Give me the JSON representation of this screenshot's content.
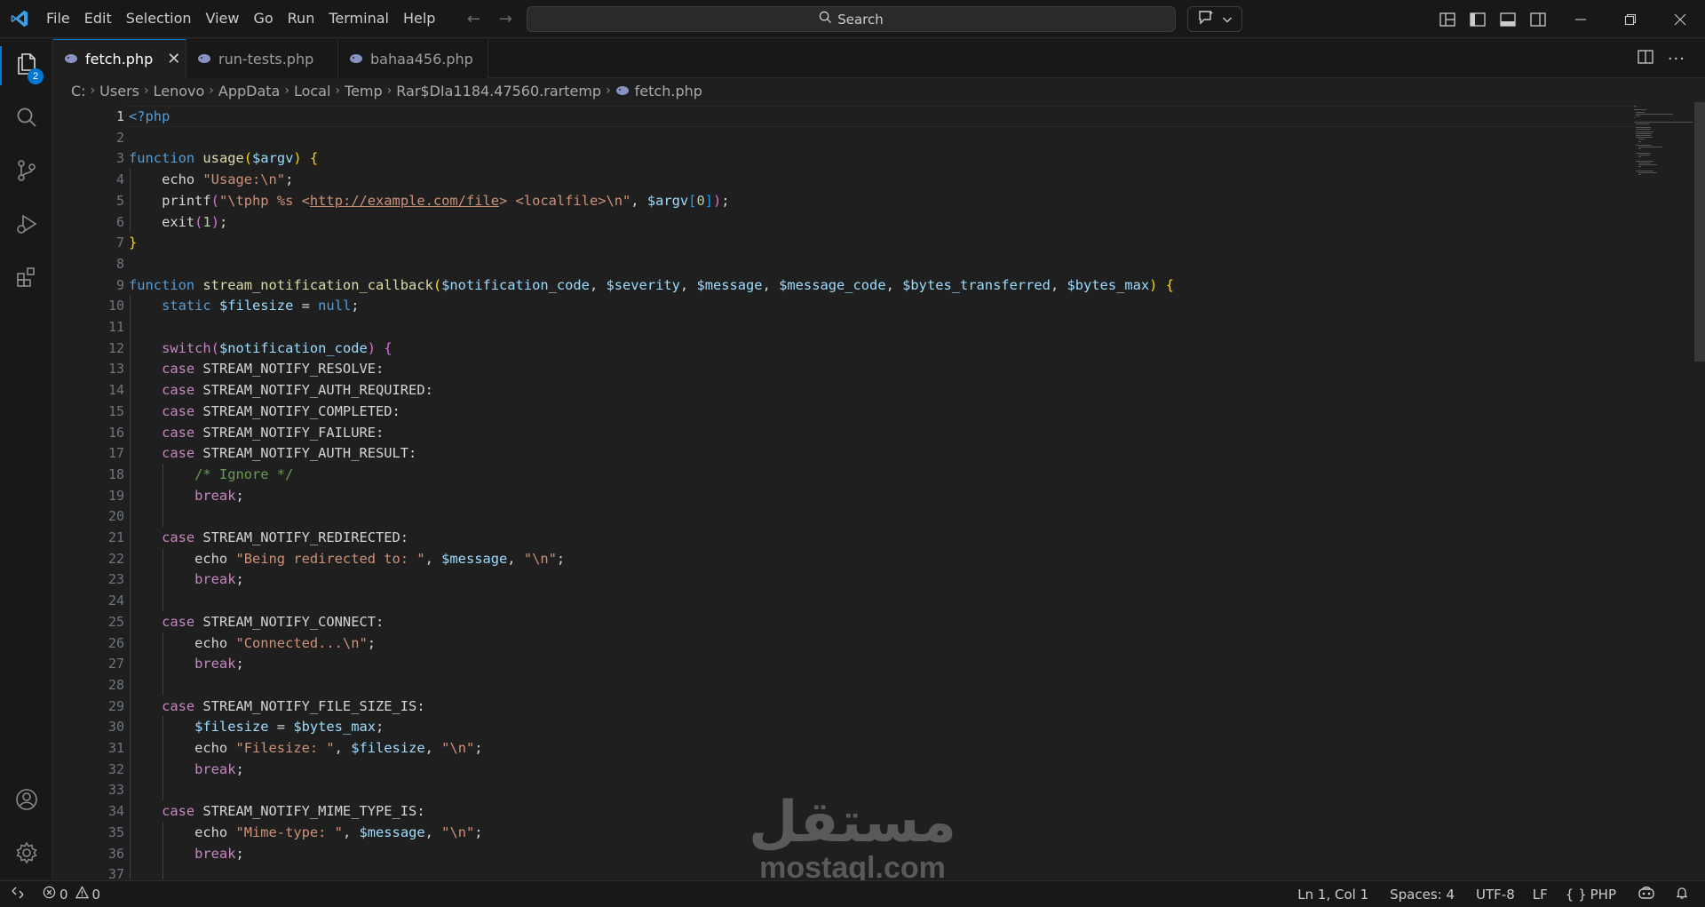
{
  "menubar": {
    "items": [
      "File",
      "Edit",
      "Selection",
      "View",
      "Go",
      "Run",
      "Terminal",
      "Help"
    ]
  },
  "command_center": {
    "label": "Search"
  },
  "activity_bar": {
    "explorer_badge": "2"
  },
  "tabs": [
    {
      "label": "fetch.php",
      "active": true
    },
    {
      "label": "run-tests.php",
      "active": false
    },
    {
      "label": "bahaa456.php",
      "active": false
    }
  ],
  "breadcrumb": [
    "C:",
    "Users",
    "Lenovo",
    "AppData",
    "Local",
    "Temp",
    "Rar$DIa1184.47560.rartemp",
    "fetch.php"
  ],
  "editor": {
    "line_numbers": [
      "1",
      "2",
      "3",
      "4",
      "5",
      "6",
      "7",
      "8",
      "9",
      "10",
      "11",
      "12",
      "13",
      "14",
      "15",
      "16",
      "17",
      "18",
      "19",
      "20",
      "21",
      "22",
      "23",
      "24",
      "25",
      "26",
      "27",
      "28",
      "29",
      "30",
      "31",
      "32",
      "33",
      "34",
      "35",
      "36",
      "37"
    ],
    "lines": [
      [
        [
          "tag",
          "<?php"
        ]
      ],
      [],
      [
        [
          "kw",
          "function "
        ],
        [
          "fn",
          "usage"
        ],
        [
          "b1",
          "("
        ],
        [
          "var",
          "$argv"
        ],
        [
          "b1",
          ")"
        ],
        [
          "const",
          " "
        ],
        [
          "b1",
          "{"
        ]
      ],
      [
        [
          "const",
          "    echo "
        ],
        [
          "str",
          "\"Usage:\\n\""
        ],
        [
          "const",
          ";"
        ]
      ],
      [
        [
          "const",
          "    printf"
        ],
        [
          "b2",
          "("
        ],
        [
          "str",
          "\"\\tphp %s <"
        ],
        [
          "lnk",
          "http://example.com/file"
        ],
        [
          "str",
          "> <localfile>\\n\""
        ],
        [
          "const",
          ", "
        ],
        [
          "var",
          "$argv"
        ],
        [
          "b3",
          "["
        ],
        [
          "num",
          "0"
        ],
        [
          "b3",
          "]"
        ],
        [
          "b2",
          ")"
        ],
        [
          "const",
          ";"
        ]
      ],
      [
        [
          "const",
          "    exit"
        ],
        [
          "b2",
          "("
        ],
        [
          "num",
          "1"
        ],
        [
          "b2",
          ")"
        ],
        [
          "const",
          ";"
        ]
      ],
      [
        [
          "b1",
          "}"
        ]
      ],
      [],
      [
        [
          "kw",
          "function "
        ],
        [
          "fn",
          "stream_notification_callback"
        ],
        [
          "b1",
          "("
        ],
        [
          "var",
          "$notification_code"
        ],
        [
          "const",
          ", "
        ],
        [
          "var",
          "$severity"
        ],
        [
          "const",
          ", "
        ],
        [
          "var",
          "$message"
        ],
        [
          "const",
          ", "
        ],
        [
          "var",
          "$message_code"
        ],
        [
          "const",
          ", "
        ],
        [
          "var",
          "$bytes_transferred"
        ],
        [
          "const",
          ", "
        ],
        [
          "var",
          "$bytes_max"
        ],
        [
          "b1",
          ")"
        ],
        [
          "const",
          " "
        ],
        [
          "b1",
          "{"
        ]
      ],
      [
        [
          "kw",
          "    static "
        ],
        [
          "var",
          "$filesize"
        ],
        [
          "const",
          " = "
        ],
        [
          "kw",
          "null"
        ],
        [
          "const",
          ";"
        ]
      ],
      [],
      [
        [
          "ctrl",
          "    switch"
        ],
        [
          "b2",
          "("
        ],
        [
          "var",
          "$notification_code"
        ],
        [
          "b2",
          ")"
        ],
        [
          "const",
          " "
        ],
        [
          "b2",
          "{"
        ]
      ],
      [
        [
          "ctrl",
          "    case "
        ],
        [
          "const",
          "STREAM_NOTIFY_RESOLVE:"
        ]
      ],
      [
        [
          "ctrl",
          "    case "
        ],
        [
          "const",
          "STREAM_NOTIFY_AUTH_REQUIRED:"
        ]
      ],
      [
        [
          "ctrl",
          "    case "
        ],
        [
          "const",
          "STREAM_NOTIFY_COMPLETED:"
        ]
      ],
      [
        [
          "ctrl",
          "    case "
        ],
        [
          "const",
          "STREAM_NOTIFY_FAILURE:"
        ]
      ],
      [
        [
          "ctrl",
          "    case "
        ],
        [
          "const",
          "STREAM_NOTIFY_AUTH_RESULT:"
        ]
      ],
      [
        [
          "cmt",
          "        /* Ignore */"
        ]
      ],
      [
        [
          "ctrl",
          "        break"
        ],
        [
          "const",
          ";"
        ]
      ],
      [],
      [
        [
          "ctrl",
          "    case "
        ],
        [
          "const",
          "STREAM_NOTIFY_REDIRECTED:"
        ]
      ],
      [
        [
          "const",
          "        echo "
        ],
        [
          "str",
          "\"Being redirected to: \""
        ],
        [
          "const",
          ", "
        ],
        [
          "var",
          "$message"
        ],
        [
          "const",
          ", "
        ],
        [
          "str",
          "\"\\n\""
        ],
        [
          "const",
          ";"
        ]
      ],
      [
        [
          "ctrl",
          "        break"
        ],
        [
          "const",
          ";"
        ]
      ],
      [],
      [
        [
          "ctrl",
          "    case "
        ],
        [
          "const",
          "STREAM_NOTIFY_CONNECT:"
        ]
      ],
      [
        [
          "const",
          "        echo "
        ],
        [
          "str",
          "\"Connected...\\n\""
        ],
        [
          "const",
          ";"
        ]
      ],
      [
        [
          "ctrl",
          "        break"
        ],
        [
          "const",
          ";"
        ]
      ],
      [],
      [
        [
          "ctrl",
          "    case "
        ],
        [
          "const",
          "STREAM_NOTIFY_FILE_SIZE_IS:"
        ]
      ],
      [
        [
          "var",
          "        $filesize"
        ],
        [
          "const",
          " = "
        ],
        [
          "var",
          "$bytes_max"
        ],
        [
          "const",
          ";"
        ]
      ],
      [
        [
          "const",
          "        echo "
        ],
        [
          "str",
          "\"Filesize: \""
        ],
        [
          "const",
          ", "
        ],
        [
          "var",
          "$filesize"
        ],
        [
          "const",
          ", "
        ],
        [
          "str",
          "\"\\n\""
        ],
        [
          "const",
          ";"
        ]
      ],
      [
        [
          "ctrl",
          "        break"
        ],
        [
          "const",
          ";"
        ]
      ],
      [],
      [
        [
          "ctrl",
          "    case "
        ],
        [
          "const",
          "STREAM_NOTIFY_MIME_TYPE_IS:"
        ]
      ],
      [
        [
          "const",
          "        echo "
        ],
        [
          "str",
          "\"Mime-type: \""
        ],
        [
          "const",
          ", "
        ],
        [
          "var",
          "$message"
        ],
        [
          "const",
          ", "
        ],
        [
          "str",
          "\"\\n\""
        ],
        [
          "const",
          ";"
        ]
      ],
      [
        [
          "ctrl",
          "        break"
        ],
        [
          "const",
          ";"
        ]
      ],
      []
    ]
  },
  "watermark": {
    "logo": "مستقل",
    "text": "mostaql.com"
  },
  "statusbar": {
    "errors": "0",
    "warnings": "0",
    "cursor": "Ln 1, Col 1",
    "indent": "Spaces: 4",
    "encoding": "UTF-8",
    "eol": "LF",
    "language": "PHP"
  },
  "colors": {
    "accent": "#0078d4",
    "background": "#1f1f1f",
    "chrome": "#181818"
  }
}
